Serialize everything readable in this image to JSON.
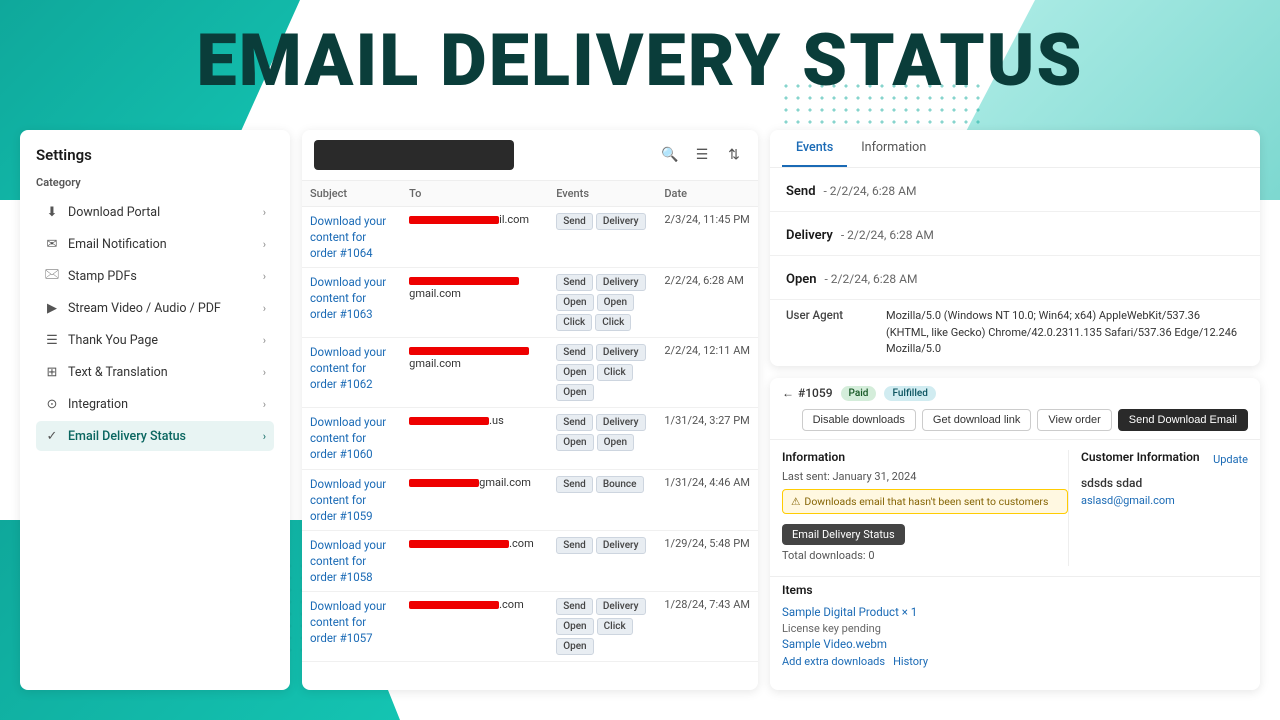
{
  "hero": {
    "title": "EMAIL DELIVERY STATUS"
  },
  "settings": {
    "title": "Settings",
    "category_label": "Category",
    "menu_items": [
      {
        "id": "download-portal",
        "icon": "⬇",
        "label": "Download Portal",
        "active": false
      },
      {
        "id": "email-notification",
        "icon": "✉",
        "label": "Email Notification",
        "active": false
      },
      {
        "id": "stamp-pdfs",
        "icon": "🖂",
        "label": "Stamp PDFs",
        "active": false
      },
      {
        "id": "stream-video",
        "icon": "▶",
        "label": "Stream Video / Audio / PDF",
        "active": false
      },
      {
        "id": "thank-you-page",
        "icon": "☰",
        "label": "Thank You Page",
        "active": false
      },
      {
        "id": "text-translation",
        "icon": "⊞",
        "label": "Text & Translation",
        "active": false
      },
      {
        "id": "integration",
        "icon": "⊙",
        "label": "Integration",
        "active": false
      },
      {
        "id": "email-delivery-status",
        "icon": "✓",
        "label": "Email Delivery Status",
        "active": true
      }
    ]
  },
  "email_table": {
    "columns": [
      "Subject",
      "To",
      "Events",
      "Date"
    ],
    "rows": [
      {
        "subject": "Download your content for order #1064",
        "to_redact_width": 90,
        "to_suffix": "il.com",
        "events": [
          "Send",
          "Delivery"
        ],
        "date": "2/3/24, 11:45 PM"
      },
      {
        "subject": "Download your content for order #1063",
        "to_redact_width": 110,
        "to_suffix": "gmail.com",
        "events": [
          "Send",
          "Delivery",
          "Open",
          "Open",
          "Click",
          "Click"
        ],
        "date": "2/2/24, 6:28 AM"
      },
      {
        "subject": "Download your content for order #1062",
        "to_redact_width": 120,
        "to_suffix": "gmail.com",
        "events": [
          "Send",
          "Delivery",
          "Open",
          "Click",
          "Open"
        ],
        "date": "2/2/24, 12:11 AM"
      },
      {
        "subject": "Download your content for order #1060",
        "to_redact_width": 80,
        "to_suffix": ".us",
        "events": [
          "Send",
          "Delivery",
          "Open",
          "Open"
        ],
        "date": "1/31/24, 3:27 PM"
      },
      {
        "subject": "Download your content for order #1059",
        "to_redact_width": 70,
        "to_suffix": "gmail.com",
        "events": [
          "Send",
          "Bounce"
        ],
        "date": "1/31/24, 4:46 AM"
      },
      {
        "subject": "Download your content for order #1058",
        "to_redact_width": 100,
        "to_suffix": ".com",
        "events": [
          "Send",
          "Delivery"
        ],
        "date": "1/29/24, 5:48 PM"
      },
      {
        "subject": "Download your content for order #1057",
        "to_redact_width": 90,
        "to_suffix": ".com",
        "events": [
          "Send",
          "Delivery",
          "Open",
          "Click",
          "Open"
        ],
        "date": "1/28/24, 7:43 AM"
      }
    ]
  },
  "events_panel": {
    "tabs": [
      "Events",
      "Information"
    ],
    "active_tab": "Events",
    "events": [
      {
        "name": "Send",
        "time": "- 2/2/24, 6:28 AM",
        "details": []
      },
      {
        "name": "Delivery",
        "time": "- 2/2/24, 6:28 AM",
        "details": []
      },
      {
        "name": "Open",
        "time": "- 2/2/24, 6:28 AM",
        "details": [
          {
            "label": "User Agent",
            "value": "Mozilla/5.0 (Windows NT 10.0; Win64; x64) AppleWebKit/537.36 (KHTML, like Gecko) Chrome/42.0.2311.135 Safari/537.36 Edge/12.246 Mozilla/5.0"
          }
        ]
      }
    ]
  },
  "order_panel": {
    "order_number": "#1059",
    "badges": [
      "Paid",
      "Fulfilled"
    ],
    "actions": [
      "Disable downloads",
      "Get download link",
      "View order",
      "Send Download Email"
    ],
    "info_section_title": "Information",
    "last_sent": "Last sent: January 31, 2024",
    "warning": "Downloads email that hasn't been sent to customers",
    "email_status_btn": "Email Delivery Status",
    "total_downloads": "Total downloads: 0",
    "customer_section_title": "Customer Information",
    "update_label": "Update",
    "customer_name": "sdsds sdad",
    "customer_email": "aslasd@gmail.com",
    "items_section_title": "Items",
    "item_name": "Sample Digital Product",
    "item_qty": "× 1",
    "license_key": "License key pending",
    "item_file": "Sample Video.webm",
    "item_actions": [
      "Add extra downloads",
      "History"
    ]
  }
}
